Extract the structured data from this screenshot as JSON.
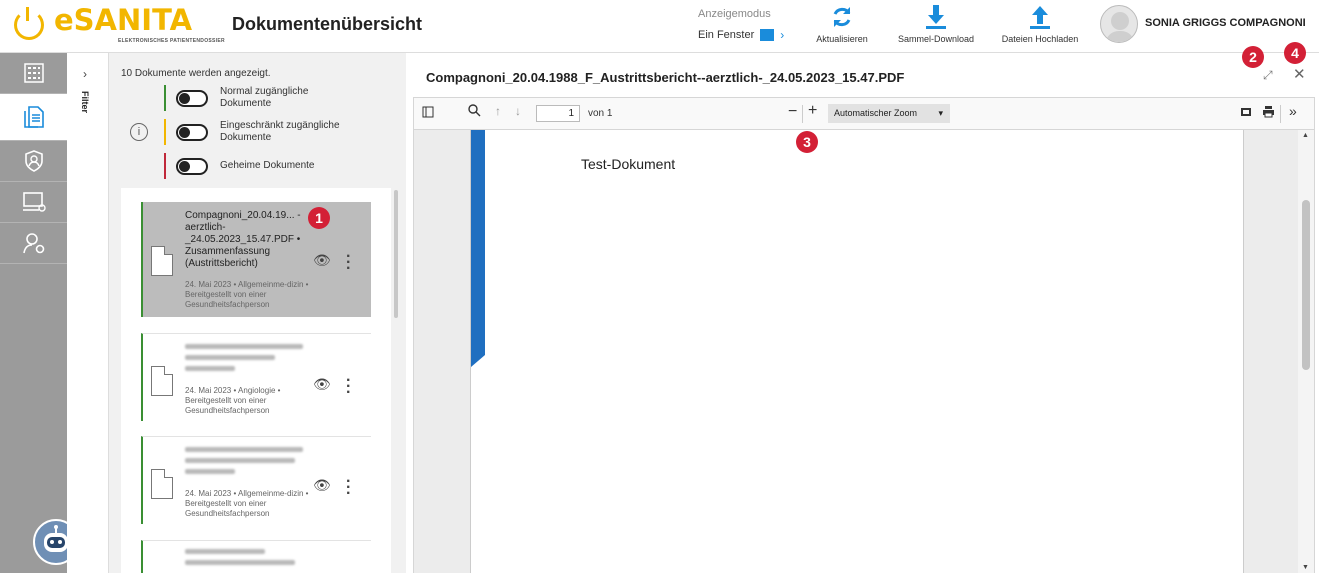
{
  "header": {
    "logo_word": "SANITA",
    "logo_e": "e",
    "logo_subtitle": "ELEKTRONISCHES PATIENTENDOSSIER",
    "page_title": "Dokumentenübersicht",
    "display_mode_label": "Anzeigemodus",
    "display_mode_value": "Ein Fenster",
    "refresh_label": "Aktualisieren",
    "bulk_download_label": "Sammel-Download",
    "upload_label": "Dateien Hochladen",
    "user_name": "SONIA GRIGGS COMPAGNONI",
    "accent_color": "#1a8cdb",
    "logo_color": "#f2b600"
  },
  "nav": {
    "items": [
      "grid-icon",
      "documents-icon",
      "privacy-shield-icon",
      "monitor-settings-icon",
      "user-settings-icon"
    ],
    "active_index": 1
  },
  "filter": {
    "label": "Filter"
  },
  "list": {
    "count_text": "10 Dokumente werden angezeigt.",
    "legend": [
      {
        "label": "Normal zugängliche Dokumente",
        "color": "#3a8f33"
      },
      {
        "label": "Eingeschränkt zugängliche Dokumente",
        "color": "#f2b600"
      },
      {
        "label": "Geheime Dokumente",
        "color": "#c0283a"
      }
    ],
    "cards": [
      {
        "title": "Compagnoni_20.04.19... -aerztlich- _24.05.2023_15.47.PDF • Zusammenfassung (Austrittsbericht)",
        "meta": "24. Mai 2023 • Allgemeinme-dizin • Bereitgestellt von einer Gesundheitsfachperson",
        "selected": true
      },
      {
        "title": "",
        "meta": "24. Mai 2023 • Angiologie • Bereitgestellt von einer Gesundheitsfachperson",
        "selected": false
      },
      {
        "title": "",
        "meta": "24. Mai 2023 • Allgemeinme-dizin • Bereitgestellt von einer Gesundheitsfachperson",
        "selected": false
      }
    ]
  },
  "badges": [
    "1",
    "2",
    "3",
    "4"
  ],
  "viewer": {
    "title": "Compagnoni_20.04.1988_F_Austrittsbericht--aerztlich-_24.05.2023_15.47.PDF",
    "page_current": "1",
    "page_of": "von 1",
    "zoom": "Automatischer Zoom",
    "document_text": "Test-Dokument"
  }
}
